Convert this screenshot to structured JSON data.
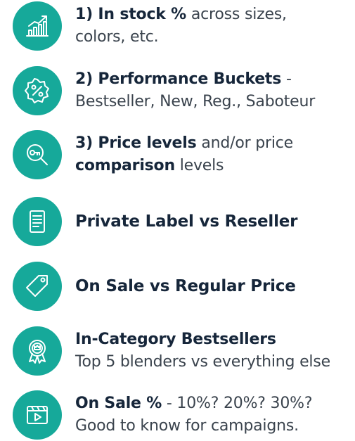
{
  "accent_color": "#16a99a",
  "items": [
    {
      "icon": "bar-chart-growth-icon",
      "line1_bold": "1) In stock %",
      "line1_light": " across sizes,",
      "line2_bold": "",
      "line2_light": "colors, etc."
    },
    {
      "icon": "percent-badge-icon",
      "line1_bold": "2) Performance Buckets",
      "line1_light": " -",
      "line2_bold": "",
      "line2_light": "Bestseller, New, Reg., Saboteur"
    },
    {
      "icon": "magnifier-key-icon",
      "line1_bold": "3) Price levels",
      "line1_light": " and/or price",
      "line2_bold": "comparison",
      "line2_light": " levels"
    },
    {
      "icon": "document-icon",
      "line1_bold": "Private Label vs Reseller"
    },
    {
      "icon": "price-tag-icon",
      "line1_bold": "On Sale vs Regular Price"
    },
    {
      "icon": "award-ribbon-icon",
      "line1_bold": "In-Category Bestsellers",
      "line1_light": "",
      "line2_bold": "",
      "line2_light": "Top 5 blenders vs everything else"
    },
    {
      "icon": "video-player-icon",
      "line1_bold": "On Sale %",
      "line1_light": " - 10%? 20%? 30%?",
      "line2_bold": "",
      "line2_light": "Good to know for campaigns."
    }
  ]
}
